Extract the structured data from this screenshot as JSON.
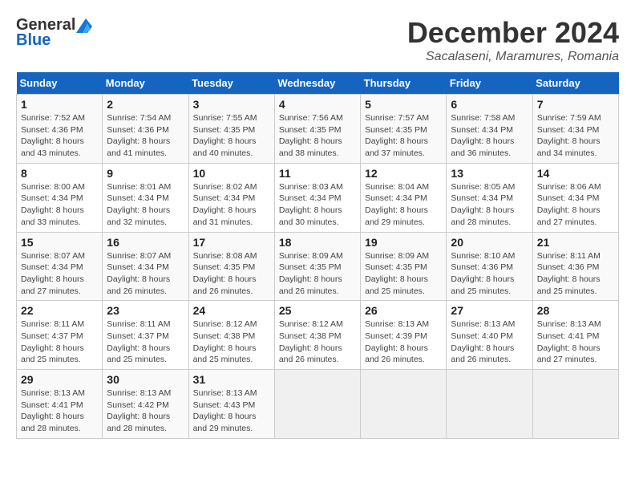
{
  "logo": {
    "line1": "General",
    "line2": "Blue"
  },
  "title": "December 2024",
  "location": "Sacalaseni, Maramures, Romania",
  "days_header": [
    "Sunday",
    "Monday",
    "Tuesday",
    "Wednesday",
    "Thursday",
    "Friday",
    "Saturday"
  ],
  "weeks": [
    [
      {
        "day": "1",
        "detail": "Sunrise: 7:52 AM\nSunset: 4:36 PM\nDaylight: 8 hours\nand 43 minutes."
      },
      {
        "day": "2",
        "detail": "Sunrise: 7:54 AM\nSunset: 4:36 PM\nDaylight: 8 hours\nand 41 minutes."
      },
      {
        "day": "3",
        "detail": "Sunrise: 7:55 AM\nSunset: 4:35 PM\nDaylight: 8 hours\nand 40 minutes."
      },
      {
        "day": "4",
        "detail": "Sunrise: 7:56 AM\nSunset: 4:35 PM\nDaylight: 8 hours\nand 38 minutes."
      },
      {
        "day": "5",
        "detail": "Sunrise: 7:57 AM\nSunset: 4:35 PM\nDaylight: 8 hours\nand 37 minutes."
      },
      {
        "day": "6",
        "detail": "Sunrise: 7:58 AM\nSunset: 4:34 PM\nDaylight: 8 hours\nand 36 minutes."
      },
      {
        "day": "7",
        "detail": "Sunrise: 7:59 AM\nSunset: 4:34 PM\nDaylight: 8 hours\nand 34 minutes."
      }
    ],
    [
      {
        "day": "8",
        "detail": "Sunrise: 8:00 AM\nSunset: 4:34 PM\nDaylight: 8 hours\nand 33 minutes."
      },
      {
        "day": "9",
        "detail": "Sunrise: 8:01 AM\nSunset: 4:34 PM\nDaylight: 8 hours\nand 32 minutes."
      },
      {
        "day": "10",
        "detail": "Sunrise: 8:02 AM\nSunset: 4:34 PM\nDaylight: 8 hours\nand 31 minutes."
      },
      {
        "day": "11",
        "detail": "Sunrise: 8:03 AM\nSunset: 4:34 PM\nDaylight: 8 hours\nand 30 minutes."
      },
      {
        "day": "12",
        "detail": "Sunrise: 8:04 AM\nSunset: 4:34 PM\nDaylight: 8 hours\nand 29 minutes."
      },
      {
        "day": "13",
        "detail": "Sunrise: 8:05 AM\nSunset: 4:34 PM\nDaylight: 8 hours\nand 28 minutes."
      },
      {
        "day": "14",
        "detail": "Sunrise: 8:06 AM\nSunset: 4:34 PM\nDaylight: 8 hours\nand 27 minutes."
      }
    ],
    [
      {
        "day": "15",
        "detail": "Sunrise: 8:07 AM\nSunset: 4:34 PM\nDaylight: 8 hours\nand 27 minutes."
      },
      {
        "day": "16",
        "detail": "Sunrise: 8:07 AM\nSunset: 4:34 PM\nDaylight: 8 hours\nand 26 minutes."
      },
      {
        "day": "17",
        "detail": "Sunrise: 8:08 AM\nSunset: 4:35 PM\nDaylight: 8 hours\nand 26 minutes."
      },
      {
        "day": "18",
        "detail": "Sunrise: 8:09 AM\nSunset: 4:35 PM\nDaylight: 8 hours\nand 26 minutes."
      },
      {
        "day": "19",
        "detail": "Sunrise: 8:09 AM\nSunset: 4:35 PM\nDaylight: 8 hours\nand 25 minutes."
      },
      {
        "day": "20",
        "detail": "Sunrise: 8:10 AM\nSunset: 4:36 PM\nDaylight: 8 hours\nand 25 minutes."
      },
      {
        "day": "21",
        "detail": "Sunrise: 8:11 AM\nSunset: 4:36 PM\nDaylight: 8 hours\nand 25 minutes."
      }
    ],
    [
      {
        "day": "22",
        "detail": "Sunrise: 8:11 AM\nSunset: 4:37 PM\nDaylight: 8 hours\nand 25 minutes."
      },
      {
        "day": "23",
        "detail": "Sunrise: 8:11 AM\nSunset: 4:37 PM\nDaylight: 8 hours\nand 25 minutes."
      },
      {
        "day": "24",
        "detail": "Sunrise: 8:12 AM\nSunset: 4:38 PM\nDaylight: 8 hours\nand 25 minutes."
      },
      {
        "day": "25",
        "detail": "Sunrise: 8:12 AM\nSunset: 4:38 PM\nDaylight: 8 hours\nand 26 minutes."
      },
      {
        "day": "26",
        "detail": "Sunrise: 8:13 AM\nSunset: 4:39 PM\nDaylight: 8 hours\nand 26 minutes."
      },
      {
        "day": "27",
        "detail": "Sunrise: 8:13 AM\nSunset: 4:40 PM\nDaylight: 8 hours\nand 26 minutes."
      },
      {
        "day": "28",
        "detail": "Sunrise: 8:13 AM\nSunset: 4:41 PM\nDaylight: 8 hours\nand 27 minutes."
      }
    ],
    [
      {
        "day": "29",
        "detail": "Sunrise: 8:13 AM\nSunset: 4:41 PM\nDaylight: 8 hours\nand 28 minutes."
      },
      {
        "day": "30",
        "detail": "Sunrise: 8:13 AM\nSunset: 4:42 PM\nDaylight: 8 hours\nand 28 minutes."
      },
      {
        "day": "31",
        "detail": "Sunrise: 8:13 AM\nSunset: 4:43 PM\nDaylight: 8 hours\nand 29 minutes."
      },
      {
        "day": "",
        "detail": ""
      },
      {
        "day": "",
        "detail": ""
      },
      {
        "day": "",
        "detail": ""
      },
      {
        "day": "",
        "detail": ""
      }
    ]
  ]
}
